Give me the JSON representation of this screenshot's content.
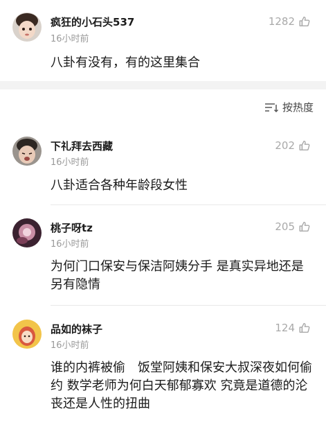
{
  "top_comment": {
    "user": "疯狂的小石头537",
    "time": "16小时前",
    "likes": "1282",
    "text": "八卦有没有，有的这里集合"
  },
  "sort": {
    "label": "按热度",
    "icon": "sort-lines-icon"
  },
  "comments": [
    {
      "user": "下礼拜去西藏",
      "time": "16小时前",
      "likes": "202",
      "text": "八卦适合各种年龄段女性"
    },
    {
      "user": "桃子呀tz",
      "time": "16小时前",
      "likes": "205",
      "text": "为何门口保安与保洁阿姨分手 是真实异地还是另有隐情"
    },
    {
      "user": "品如的袜子",
      "time": "16小时前",
      "likes": "124",
      "text": "谁的内裤被偷　饭堂阿姨和保安大叔深夜如何偷约  数学老师为何白天郁郁寡欢  究竟是道德的沦丧还是人性的扭曲"
    }
  ],
  "icons": {
    "like": "thumbs-up-icon"
  },
  "colors": {
    "muted": "#a9a9a9",
    "section_gap": "#f3f3f3"
  }
}
